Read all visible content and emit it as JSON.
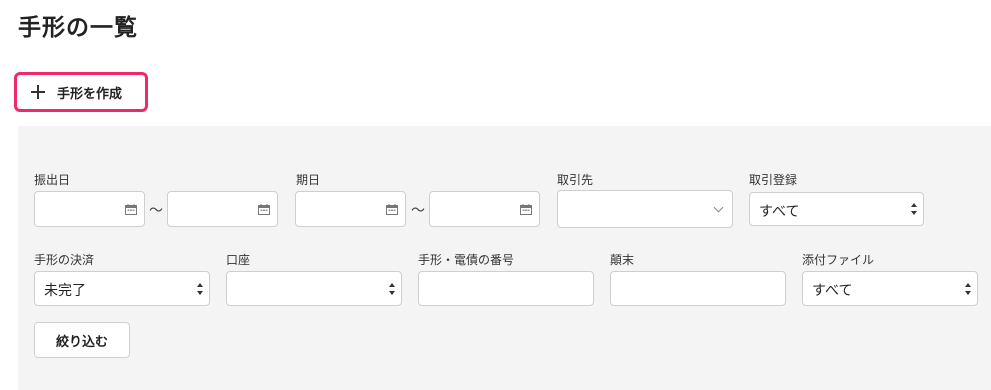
{
  "page": {
    "title": "手形の一覧"
  },
  "toolbar": {
    "create_label": "手形を作成"
  },
  "filters": {
    "issue_date": {
      "label": "振出日",
      "range_separator": "〜"
    },
    "due_date": {
      "label": "期日",
      "range_separator": "〜"
    },
    "partner": {
      "label": "取引先",
      "value": ""
    },
    "registration": {
      "label": "取引登録",
      "value": "すべて"
    },
    "settlement": {
      "label": "手形の決済",
      "value": "未完了"
    },
    "account": {
      "label": "口座",
      "value": ""
    },
    "number": {
      "label": "手形・電債の番号",
      "value": ""
    },
    "summary": {
      "label": "顛末",
      "value": ""
    },
    "attachment": {
      "label": "添付ファイル",
      "value": "すべて"
    },
    "apply_label": "絞り込む"
  },
  "colors": {
    "highlight_border": "#ee2a6b",
    "panel_background": "#f5f4f4"
  },
  "icons": {
    "create": "plus-icon",
    "date": "calendar-icon",
    "select": "sort-arrows-icon",
    "dropdown": "chevron-down-icon"
  }
}
